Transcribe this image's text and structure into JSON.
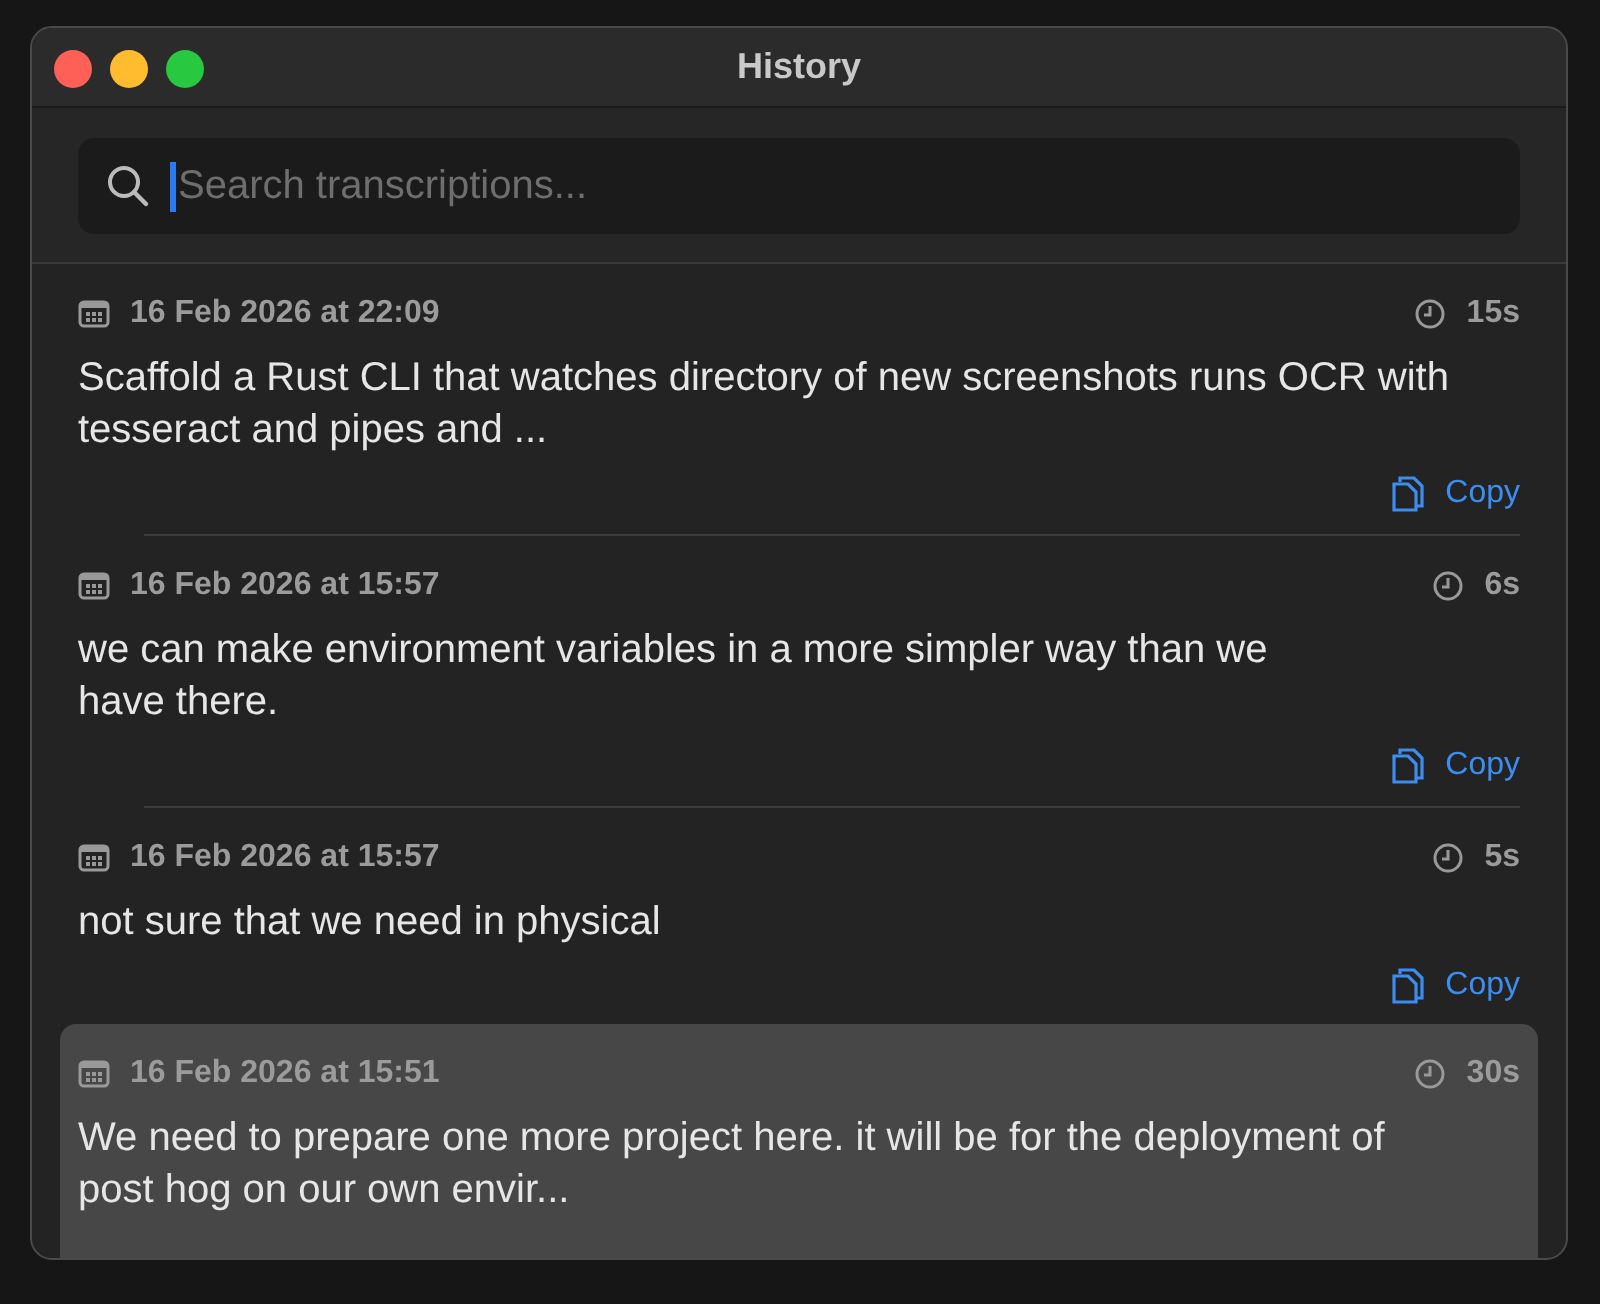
{
  "window": {
    "title": "History"
  },
  "search": {
    "placeholder": "Search transcriptions..."
  },
  "entries": [
    {
      "date": "16 Feb 2026 at 22:09",
      "duration": "15s",
      "text": "Scaffold a Rust CLI that watches directory of new screenshots runs OCR with\ntesseract and pipes and ...",
      "copy": "Copy",
      "selected": false
    },
    {
      "date": "16 Feb 2026 at 15:57",
      "duration": "6s",
      "text": "we can make environment variables in a more simpler way than we\nhave there.",
      "copy": "Copy",
      "selected": false
    },
    {
      "date": "16 Feb 2026 at 15:57",
      "duration": "5s",
      "text": "not sure that we need in physical",
      "copy": "Copy",
      "selected": false
    },
    {
      "date": "16 Feb 2026 at 15:51",
      "duration": "30s",
      "text": "We need to prepare one more project here. it will be for the deployment of\npost hog on our own envir...",
      "selected": true
    }
  ]
}
